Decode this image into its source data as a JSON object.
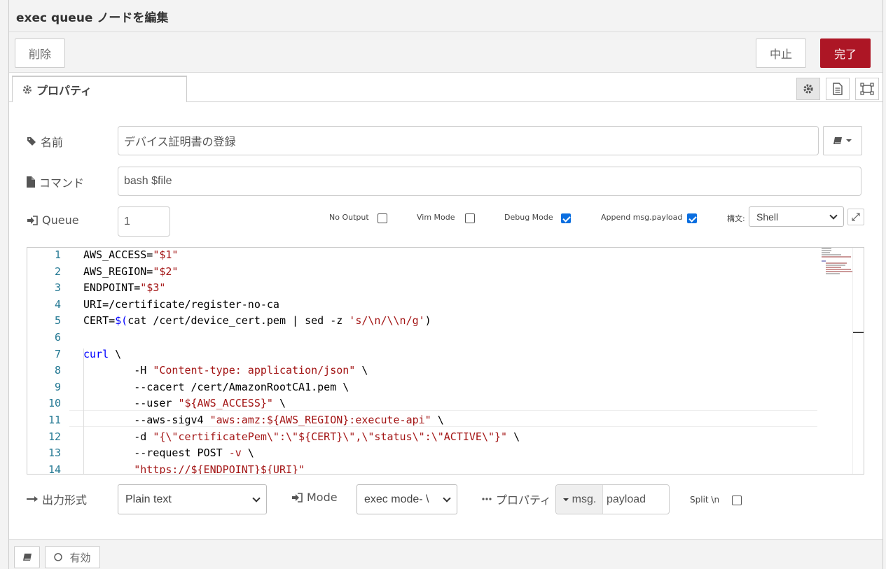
{
  "dialog": {
    "title": "exec queue ノードを編集",
    "delete_label": "削除",
    "cancel_label": "中止",
    "done_label": "完了"
  },
  "tabs": {
    "properties_label": "プロパティ"
  },
  "fields": {
    "name_label": "名前",
    "name_value": "デバイス証明書の登録",
    "command_label": "コマンド",
    "command_value": "bash $file",
    "queue_label": "Queue",
    "queue_value": "1",
    "no_output_label": "No Output",
    "no_output_checked": false,
    "vim_mode_label": "Vim Mode",
    "vim_mode_checked": false,
    "debug_mode_label": "Debug Mode",
    "debug_mode_checked": true,
    "append_payload_label": "Append msg.payload",
    "append_payload_checked": true,
    "syntax_label": "構文:",
    "syntax_value": "Shell"
  },
  "editor": {
    "lines": [
      {
        "n": "1",
        "code": "AWS_ACCESS=\"$1\""
      },
      {
        "n": "2",
        "code": "AWS_REGION=\"$2\""
      },
      {
        "n": "3",
        "code": "ENDPOINT=\"$3\""
      },
      {
        "n": "4",
        "code": "URI=/certificate/register-no-ca"
      },
      {
        "n": "5",
        "code": "CERT=$(cat /cert/device_cert.pem | sed -z 's/\\n/\\\\n/g')"
      },
      {
        "n": "6",
        "code": ""
      },
      {
        "n": "7",
        "code": "curl \\"
      },
      {
        "n": "8",
        "code": "        -H \"Content-type: application/json\" \\"
      },
      {
        "n": "9",
        "code": "        --cacert /cert/AmazonRootCA1.pem \\"
      },
      {
        "n": "10",
        "code": "        --user \"${AWS_ACCESS}\" \\"
      },
      {
        "n": "11",
        "code": "        --aws-sigv4 \"aws:amz:${AWS_REGION}:execute-api\" \\"
      },
      {
        "n": "12",
        "code": "        -d \"{\\\"certificatePem\\\":\\\"${CERT}\\\",\\\"status\\\":\\\"ACTIVE\\\"}\" \\"
      },
      {
        "n": "13",
        "code": "        --request POST -v \\"
      },
      {
        "n": "14",
        "code": "        \"https://${ENDPOINT}${URI}\""
      }
    ]
  },
  "output": {
    "format_label": "出力形式",
    "format_value": "Plain text",
    "mode_label": "Mode",
    "mode_value": "exec mode- \\",
    "property_label": "プロパティ",
    "property_prefix": "msg.",
    "property_value": "payload",
    "split_label": "Split \\n",
    "split_checked": false
  },
  "footer": {
    "enabled_label": "有効"
  },
  "colors": {
    "primary": "#ad1625",
    "checkbox": "#0a6ee0",
    "line_number": "#237893",
    "string": "#a31515",
    "keyword": "#0000ff"
  }
}
